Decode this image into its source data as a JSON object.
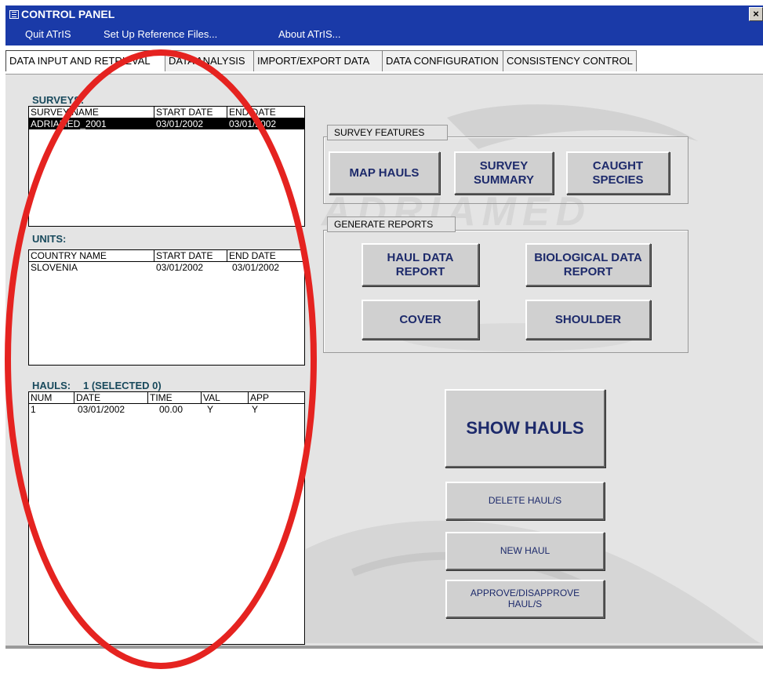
{
  "window": {
    "title": "CONTROL PANEL",
    "close_glyph": "×"
  },
  "menu": [
    {
      "label": "Quit ATrIS"
    },
    {
      "label": "Set Up Reference Files..."
    },
    {
      "label": "About ATrIS..."
    }
  ],
  "tabs": [
    {
      "label": "DATA INPUT AND RETRIEVAL"
    },
    {
      "label": "DATA ANALYSIS"
    },
    {
      "label": "IMPORT/EXPORT DATA"
    },
    {
      "label": "DATA CONFIGURATION"
    },
    {
      "label": "CONSISTENCY CONTROL"
    }
  ],
  "watermark": "ADRIAMED",
  "surveys": {
    "label": "SURVEYS:",
    "columns": [
      "SURVEY NAME",
      "START DATE",
      "END DATE"
    ],
    "rows": [
      [
        "ADRIAMED_2001",
        "03/01/2002",
        "03/01/2002"
      ]
    ]
  },
  "units": {
    "label": "UNITS:",
    "columns": [
      "COUNTRY NAME",
      "START DATE",
      "END DATE"
    ],
    "rows": [
      [
        "SLOVENIA",
        "03/01/2002",
        "03/01/2002"
      ]
    ]
  },
  "hauls": {
    "label": "HAULS:",
    "count_text": "1 (SELECTED 0)",
    "columns": [
      "NUM",
      "DATE",
      "TIME",
      "VAL",
      "APP"
    ],
    "rows": [
      [
        "1",
        "03/01/2002",
        "00.00",
        "Y",
        "Y"
      ]
    ]
  },
  "survey_features": {
    "label": "SURVEY FEATURES",
    "buttons": [
      "MAP HAULS",
      "SURVEY SUMMARY",
      "CAUGHT SPECIES"
    ]
  },
  "generate_reports": {
    "label": "GENERATE REPORTS",
    "buttons": [
      "HAUL DATA REPORT",
      "BIOLOGICAL DATA REPORT",
      "COVER",
      "SHOULDER"
    ]
  },
  "haul_actions": {
    "show_hauls": "SHOW HAULS",
    "delete_hauls": "DELETE HAUL/S",
    "new_haul": "NEW HAUL",
    "approve_hauls": "APPROVE/DISAPPROVE HAUL/S"
  },
  "colors": {
    "titlebar": "#1a3aa8",
    "panel": "#e4e4e4",
    "annotation": "#e52320",
    "button_text": "#1d2a6b"
  }
}
